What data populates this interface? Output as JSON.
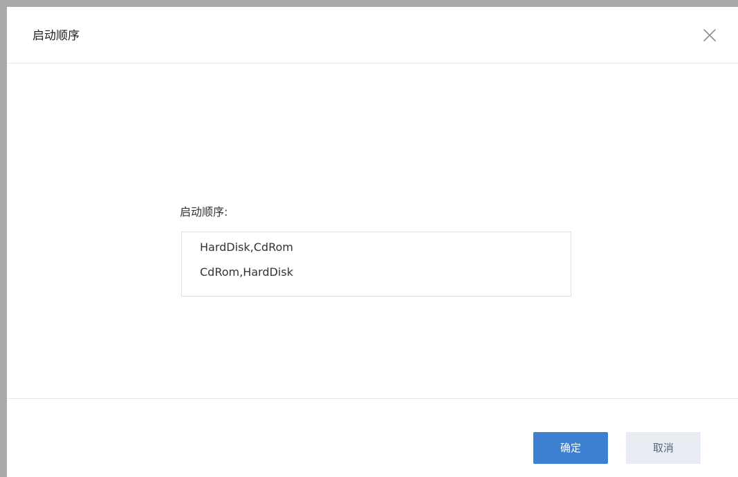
{
  "dialog": {
    "title": "启动顺序",
    "close_icon": "close-icon"
  },
  "form": {
    "label": "启动顺序:",
    "options": [
      "HardDisk,CdRom",
      "CdRom,HardDisk"
    ]
  },
  "footer": {
    "confirm_label": "确定",
    "cancel_label": "取消"
  },
  "colors": {
    "primary": "#3d7fd1",
    "secondary_button_bg": "#e8edf4",
    "border": "#dcdfe6"
  }
}
